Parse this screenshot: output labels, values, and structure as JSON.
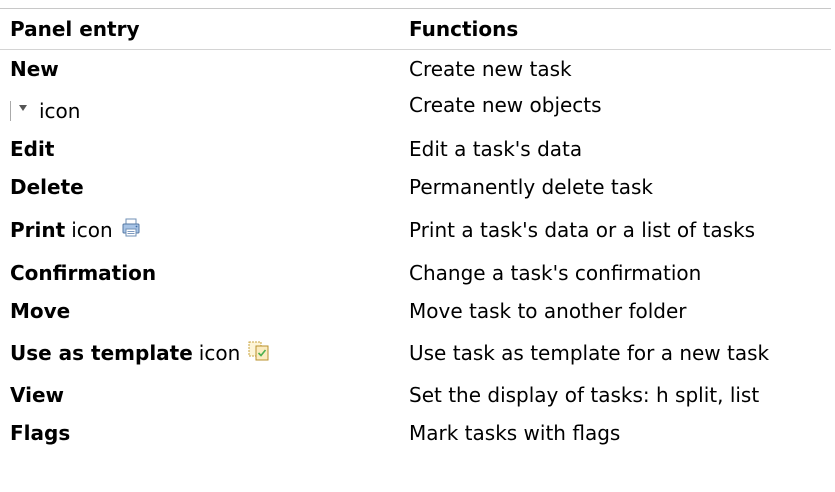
{
  "table": {
    "header": {
      "entry": "Panel entry",
      "functions": "Functions"
    },
    "rows": [
      {
        "entry": "New",
        "suffix": "",
        "function": "Create new task",
        "icon": ""
      },
      {
        "entry": "",
        "suffix": "icon",
        "function": "Create new objects",
        "icon": "dropdown-arrow-icon"
      },
      {
        "entry": "Edit",
        "suffix": "",
        "function": "Edit a task's data",
        "icon": ""
      },
      {
        "entry": "Delete",
        "suffix": "",
        "function": "Permanently delete task",
        "icon": ""
      },
      {
        "entry": "Print",
        "suffix": "icon",
        "function": "Print a task's data or a list of tasks",
        "icon": "printer-icon"
      },
      {
        "entry": "Confirmation",
        "suffix": "",
        "function": "Change a task's confirmation",
        "icon": ""
      },
      {
        "entry": "Move",
        "suffix": "",
        "function": "Move task to another folder",
        "icon": ""
      },
      {
        "entry": "Use as template",
        "suffix": "icon",
        "function": "Use task as template for a new task",
        "icon": "template-icon"
      },
      {
        "entry": "View",
        "suffix": "",
        "function": "Set the display of tasks: h split, list",
        "icon": ""
      },
      {
        "entry": "Flags",
        "suffix": "",
        "function": "Mark tasks with flags",
        "icon": ""
      }
    ]
  }
}
